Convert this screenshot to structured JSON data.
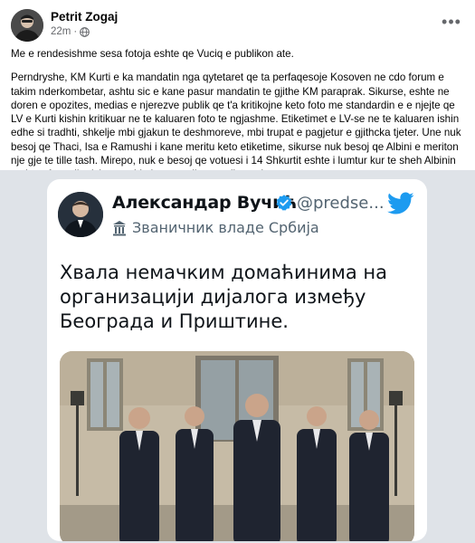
{
  "post": {
    "author": "Petrit Zogaj",
    "time": "22m",
    "more_icon": "ellipsis-icon",
    "paragraphs": [
      "Me e rendesishme sesa fotoja eshte qe Vuciq e publikon ate.",
      "Perndryshe, KM Kurti e ka mandatin nga qytetaret qe ta perfaqesoje Kosoven ne cdo forum e takim nderkombetar, ashtu sic e kane pasur mandatin te gjithe KM paraprak. Sikurse, eshte ne doren e opozites, medias e njerezve publik qe t'a kritikojne keto foto me standardin e e njejte qe LV e Kurti kishin kritikuar ne te kaluaren foto te ngjashme. Etiketimet e LV-se ne te kaluaren ishin edhe si tradhti, shkelje mbi gjakun te deshmoreve, mbi trupat e pagjetur e gjithcka tjeter. Une nuk besoj qe Thaci, Isa e Ramushi i kane meritu keto etiketime, sikurse nuk besoj qe Albini e meriton nje gje te tille tash. Mirepo, nuk e besoj qe votuesi i 14 Shkurtit eshte i lumtur kur te sheh Albinin ne kete foto pikerisht per shkak te retorikes se tij opozitare."
    ]
  },
  "tweet": {
    "name": "Александар Вучић",
    "handle": "@predse...",
    "subtitle": "Званичник владе Србија",
    "text": "Хвала немачким домаћинима на организацији дијалога између Београда и Приштине.",
    "icons": [
      "verified-badge-icon",
      "twitter-bird-icon",
      "government-building-icon"
    ],
    "colors": {
      "twitter_blue": "#1d9bf0",
      "text": "#0f1419",
      "muted": "#536471"
    }
  }
}
